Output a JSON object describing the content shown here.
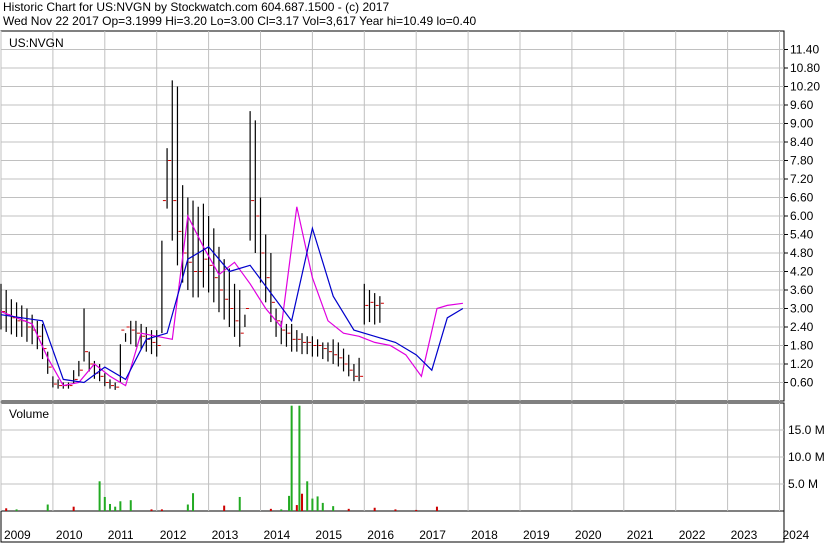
{
  "header": {
    "line1": "Historic Chart for US:NVGN by Stockwatch.com 604.687.1500 - (c) 2017",
    "line2": "Wed Nov 22 2017   Op=3.1999  Hi=3.20  Lo=3.00  Cl=3.17  Vol=3,617  Year hi=10.49  lo=0.40"
  },
  "colors": {
    "background": "#ffffff",
    "grid": "#c0c0c0",
    "price_bars": "#000000",
    "down_tick": "#cc0000",
    "ma_short": "#e000e0",
    "ma_long": "#0000cc",
    "volume_up": "#22aa22",
    "volume_down": "#cc0000"
  },
  "chart_data": [
    {
      "type": "line",
      "panel": "price",
      "label": "US:NVGN",
      "ylim": [
        0,
        12
      ],
      "y_ticks": [
        "11.40",
        "10.80",
        "10.20",
        "9.60",
        "9.00",
        "8.40",
        "7.80",
        "7.20",
        "6.60",
        "6.00",
        "5.40",
        "4.80",
        "4.20",
        "3.60",
        "3.00",
        "2.40",
        "1.80",
        "1.20",
        "0.60"
      ],
      "x_ticks": [
        "2009",
        "2010",
        "2011",
        "2012",
        "2013",
        "2014",
        "2015",
        "2016",
        "2017",
        "2018",
        "2019",
        "2020",
        "2021",
        "2022",
        "2023",
        "2024"
      ],
      "series": [
        {
          "x": [
            2009.0,
            2009.1,
            2009.2,
            2009.3,
            2009.4,
            2009.5,
            2009.6,
            2009.7,
            2009.8,
            2009.9,
            2010.0,
            2010.1,
            2010.2,
            2010.3,
            2010.4,
            2010.5,
            2010.6,
            2010.7,
            2010.8,
            2010.9,
            2011.0,
            2011.1,
            2011.2,
            2011.3,
            2011.4,
            2011.5,
            2011.6,
            2011.7,
            2011.8,
            2011.9,
            2012.0,
            2012.1,
            2012.2,
            2012.3,
            2012.4,
            2012.5,
            2012.6,
            2012.7,
            2012.8,
            2012.9,
            2013.0,
            2013.1,
            2013.2,
            2013.3,
            2013.4,
            2013.5,
            2013.6,
            2013.7,
            2013.8,
            2013.9,
            2014.0,
            2014.1,
            2014.2,
            2014.3,
            2014.4,
            2014.5,
            2014.6,
            2014.7,
            2014.8,
            2014.9,
            2015.0,
            2015.1,
            2015.2,
            2015.3,
            2015.4,
            2015.5,
            2015.6,
            2015.7,
            2015.8,
            2015.9,
            2016.0,
            2016.1,
            2016.2,
            2016.3,
            2016.4,
            2016.5,
            2016.6,
            2016.7,
            2016.8,
            2016.9,
            2017.0,
            2017.1,
            2017.2,
            2017.3,
            2017.4,
            2017.5,
            2017.6,
            2017.7,
            2017.8,
            2017.9
          ],
          "high": [
            3.8,
            3.6,
            3.3,
            3.2,
            3.1,
            3.0,
            2.8,
            2.6,
            2.5,
            1.6,
            0.8,
            0.7,
            0.6,
            0.6,
            1.0,
            1.3,
            3.0,
            1.6,
            1.3,
            1.2,
            0.9,
            0.7,
            0.6,
            0.6,
            2.2,
            2.6,
            2.6,
            2.5,
            2.4,
            2.3,
            2.3,
            2.2,
            8.2,
            10.4,
            10.2,
            7.0,
            6.6,
            6.5,
            6.3,
            6.4,
            6.0,
            5.6,
            5.0,
            4.6,
            4.3,
            3.8,
            3.6,
            2.8,
            9.4,
            9.1,
            6.6,
            5.4,
            4.8,
            3.0,
            2.6,
            2.5,
            2.5,
            2.3,
            2.2,
            2.1,
            2.1,
            2.0,
            1.9,
            1.9,
            2.0,
            1.9,
            1.7,
            1.5,
            1.2,
            1.4,
            3.8,
            3.6,
            3.5,
            3.4
          ],
          "_note": "",
          "close": [
            2.9,
            2.8,
            2.7,
            2.6,
            2.6,
            2.4,
            2.3,
            2.1,
            1.7,
            1.1,
            0.55,
            0.5,
            0.5,
            0.5,
            0.7,
            1.0,
            1.6,
            1.2,
            0.9,
            0.8,
            0.6,
            0.5,
            0.45,
            2.3,
            2.4,
            2.3,
            2.2,
            2.1,
            2.0,
            1.9,
            1.8,
            6.5,
            7.8,
            6.5,
            5.5,
            4.8,
            4.5,
            4.2,
            4.2,
            4.6,
            4.4,
            4.0,
            3.6,
            3.3,
            3.0,
            2.6,
            2.2,
            3.0,
            6.5,
            6.0,
            4.8,
            4.0,
            3.2,
            2.6,
            2.3,
            2.2,
            2.0,
            2.0,
            1.9,
            1.9,
            1.8,
            1.8,
            1.7,
            1.6,
            1.5,
            1.4,
            1.2,
            1.0,
            0.8,
            0.8,
            3.1,
            3.2,
            3.1,
            3.17
          ]
        },
        {
          "name": "",
          "x": [
            2009.0,
            2009.3,
            2009.6,
            2009.9,
            2010.2,
            2010.5,
            2010.8,
            2011.1,
            2011.4,
            2011.7,
            2012.0,
            2012.3,
            2012.6,
            2012.9,
            2013.2,
            2013.5,
            2013.8,
            2014.1,
            2014.4,
            2014.7,
            2015.0,
            2015.3,
            2015.6,
            2015.9,
            2016.2,
            2016.5,
            2016.8,
            2017.1,
            2017.4,
            2017.6,
            2017.9
          ],
          "values": [
            2.9,
            2.7,
            2.5,
            1.4,
            0.5,
            0.6,
            1.2,
            0.8,
            0.5,
            2.2,
            2.1,
            2.0,
            6.0,
            5.0,
            4.1,
            4.5,
            3.8,
            3.0,
            2.4,
            6.3,
            4.0,
            2.6,
            2.2,
            2.1,
            1.9,
            1.8,
            1.5,
            0.8,
            3.0,
            3.1,
            3.17
          ]
        },
        {
          "name": "",
          "x": [
            2009.0,
            2009.4,
            2009.8,
            2010.2,
            2010.6,
            2011.0,
            2011.4,
            2011.8,
            2012.2,
            2012.6,
            2013.0,
            2013.4,
            2013.8,
            2014.2,
            2014.6,
            2015.0,
            2015.4,
            2015.8,
            2016.2,
            2016.6,
            2017.0,
            2017.3,
            2017.6,
            2017.9
          ],
          "values": [
            2.8,
            2.7,
            2.6,
            0.7,
            0.6,
            1.1,
            0.7,
            2.0,
            2.2,
            4.6,
            5.0,
            4.2,
            4.4,
            3.5,
            2.6,
            5.6,
            3.4,
            2.3,
            2.1,
            1.9,
            1.5,
            1.0,
            2.7,
            3.0
          ]
        }
      ]
    },
    {
      "type": "bar",
      "panel": "volume",
      "label": "Volume",
      "ylim": [
        0,
        20
      ],
      "y_ticks": [
        "15.0 M",
        "10.0 M",
        "5.0 M"
      ],
      "unit": "M",
      "x": [
        2009.1,
        2009.3,
        2009.9,
        2010.4,
        2010.9,
        2011.0,
        2011.1,
        2011.2,
        2011.3,
        2011.5,
        2011.9,
        2012.1,
        2012.6,
        2012.7,
        2013.3,
        2013.6,
        2014.2,
        2014.4,
        2014.55,
        2014.6,
        2014.7,
        2014.75,
        2014.8,
        2014.9,
        2015.0,
        2015.1,
        2015.2,
        2015.4,
        2015.7,
        2016.2,
        2016.6,
        2017.0,
        2017.4
      ],
      "values": [
        0.5,
        0.3,
        1.2,
        0.8,
        5.5,
        2.6,
        1.3,
        0.8,
        1.8,
        2.0,
        0.3,
        0.3,
        1.2,
        3.3,
        1.0,
        2.6,
        0.4,
        0.3,
        2.8,
        19.5,
        1.1,
        19.5,
        3.2,
        5.5,
        2.3,
        2.7,
        1.5,
        0.9,
        0.4,
        0.6,
        0.3,
        0.2,
        0.8
      ],
      "up": [
        false,
        true,
        true,
        false,
        true,
        true,
        true,
        true,
        true,
        true,
        false,
        false,
        true,
        true,
        false,
        true,
        false,
        true,
        true,
        true,
        false,
        true,
        false,
        true,
        true,
        true,
        true,
        true,
        false,
        false,
        false,
        false,
        false
      ]
    }
  ]
}
